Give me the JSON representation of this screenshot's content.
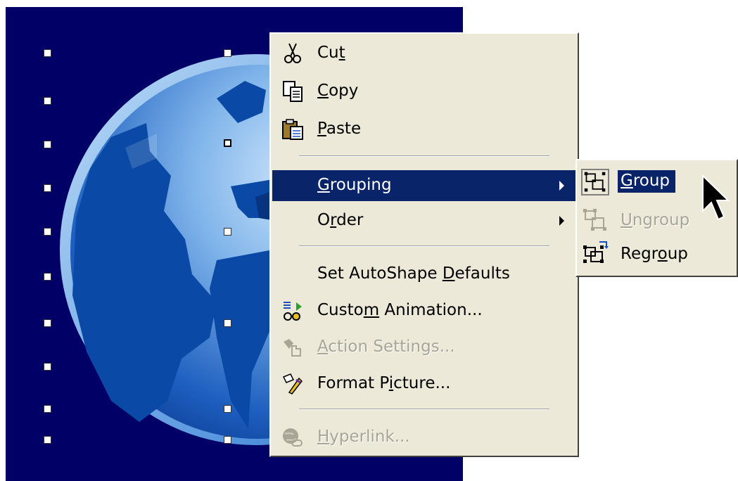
{
  "context_menu": {
    "items": [
      {
        "pre": "Cu",
        "acc": "t",
        "post": "",
        "enabled": true
      },
      {
        "pre": "",
        "acc": "C",
        "post": "opy",
        "enabled": true
      },
      {
        "pre": "",
        "acc": "P",
        "post": "aste",
        "enabled": true
      },
      {
        "pre": "",
        "acc": "G",
        "post": "rouping",
        "enabled": true
      },
      {
        "pre": "O",
        "acc": "r",
        "post": "der",
        "enabled": true
      },
      {
        "pre": "Set AutoShape ",
        "acc": "D",
        "post": "efaults",
        "enabled": true
      },
      {
        "pre": "Custo",
        "acc": "m",
        "post": " Animation...",
        "enabled": true
      },
      {
        "pre": "",
        "acc": "A",
        "post": "ction Settings...",
        "enabled": false
      },
      {
        "pre": "Format P",
        "acc": "i",
        "post": "cture...",
        "enabled": true
      },
      {
        "pre": "",
        "acc": "H",
        "post": "yperlink...",
        "enabled": false
      }
    ]
  },
  "submenu": {
    "items": [
      {
        "pre": "",
        "acc": "G",
        "post": "roup",
        "enabled": true
      },
      {
        "pre": "",
        "acc": "U",
        "post": "ngroup",
        "enabled": false
      },
      {
        "pre": "Regr",
        "acc": "o",
        "post": "up",
        "enabled": true
      }
    ]
  },
  "colors": {
    "menu_bg": "#ece9d8",
    "highlight": "#0a246a",
    "slide_bg": "#000066",
    "disabled_text": "#a8a597"
  },
  "icons": {
    "cut": "scissors-icon",
    "copy": "copy-icon",
    "paste": "paste-icon",
    "custom_animation": "custom-animation-icon",
    "action_settings": "action-settings-icon",
    "format_picture": "format-picture-icon",
    "hyperlink": "hyperlink-icon",
    "group": "group-icon",
    "ungroup": "ungroup-icon",
    "regroup": "regroup-icon",
    "cursor": "mouse-pointer-icon"
  }
}
